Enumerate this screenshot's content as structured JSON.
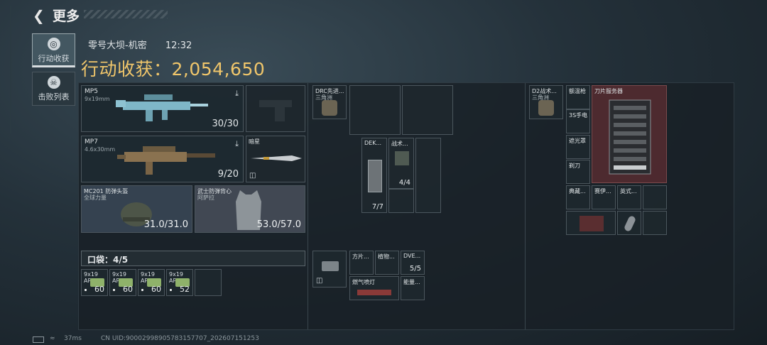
{
  "header": {
    "back_icon": "back-arrow-icon",
    "title": "更多"
  },
  "tabs": [
    {
      "label": "行动收获",
      "icon": "loot-icon"
    },
    {
      "label": "击败列表",
      "icon": "skull-icon"
    }
  ],
  "info": {
    "map": "零号大坝-机密",
    "time": "12:32",
    "haul_label": "行动收获：",
    "haul_value": "2,054,650"
  },
  "weapons": [
    {
      "name": "MP5",
      "caliber": "9x19mm",
      "ammo": "30/30"
    },
    {
      "name": "MP7",
      "caliber": "4.6x30mm",
      "ammo": "9/20"
    }
  ],
  "knife": {
    "name": "暗星"
  },
  "helmet": {
    "name": "MC201 防弹头盔",
    "sub": "全球力量",
    "durability": "31.0/31.0"
  },
  "armor": {
    "name": "武士防弹背心",
    "sub": "阿萨拉",
    "durability": "53.0/57.0"
  },
  "pocket": {
    "label": "口袋：",
    "count": "4/5"
  },
  "ammo": [
    {
      "name": "9x19",
      "sub": "AP6.3",
      "count": "60"
    },
    {
      "name": "9x19",
      "sub": "AP6.3",
      "count": "60"
    },
    {
      "name": "9x19",
      "sub": "AP6.3",
      "count": "60"
    },
    {
      "name": "9x19",
      "sub": "AP6.3",
      "count": "52"
    }
  ],
  "chest_rig": {
    "name": "DRC先进...",
    "sub": "三角洲"
  },
  "mid_items": [
    {
      "name": "DEK...",
      "count": "7/7"
    },
    {
      "name": "战术...",
      "count": "4/4"
    }
  ],
  "pouch_items": [
    {
      "name": "方片..."
    },
    {
      "name": "植物..."
    },
    {
      "name": "DVE...",
      "count": "5/5"
    },
    {
      "name": "燃气喷灯"
    },
    {
      "name": "能量..."
    }
  ],
  "backpack": {
    "name": "D2战术...",
    "sub": "三角洲"
  },
  "bag_items": [
    {
      "name": "额温枪"
    },
    {
      "name": "刀片服务器"
    },
    {
      "name": "3S手电"
    },
    {
      "name": "遮光罩"
    },
    {
      "name": "剃刀"
    },
    {
      "name": "典藏..."
    },
    {
      "name": "赛伊..."
    },
    {
      "name": "英式..."
    }
  ],
  "status": {
    "ping": "37ms",
    "uid": "CN UID:90002998905783157707_202607151253"
  }
}
